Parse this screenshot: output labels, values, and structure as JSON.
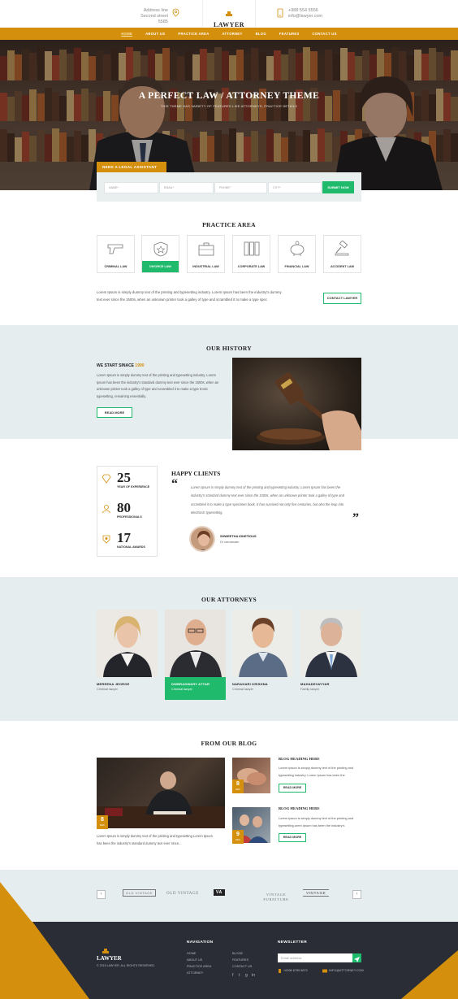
{
  "topbar": {
    "address_line1": "Address line",
    "address_line2": "Second street 5585",
    "phone": "+988 554 5556",
    "email": "info@lawyer.com",
    "brand": "LAWYER"
  },
  "nav": {
    "items": [
      "HOME",
      "ABOUT US",
      "PRACTICE AREA",
      "ATTORNEY",
      "BLOG",
      "FEATURES",
      "CONTACT US"
    ]
  },
  "hero": {
    "title": "A PERFECT LAW / ATTORNEY THEME",
    "subtitle": "THIS THEME HAS VARIETY OF FEATURES LIKE ATTORNEYS, PRACTICE DETAILS"
  },
  "assist_form": {
    "tab_label": "NEED A LEGAL ASSISTANT",
    "fields": [
      "NAME*",
      "EMAIL*",
      "PHONE*",
      "CITY*"
    ],
    "submit_label": "SUBMIT NOW"
  },
  "practice": {
    "title": "PRACTICE AREA",
    "items": [
      "CRIMINAL LAW",
      "DIVORCE LAW",
      "INDUSTRIAL LAW",
      "CORPORATE LAW",
      "FINANCIAL LAW",
      "ACCIDENT LAW"
    ],
    "text": "Lorem Ipsum is simply dummy text of the printing and typesetting industry. Lorem Ipsum has been the industry's dummy text ever since the 1500s, when an unknown printer took a galley of type and scrambled it to make a type spec",
    "contact_label": "CONTACT LAWYER"
  },
  "history": {
    "title": "OUR HISTORY",
    "heading": "WE START SINACE",
    "year": "1990",
    "text": "Lorem Ipsum is simply dummy text of the printing and typesetting industry. Lorem Ipsum has been the industry's standard dummy text ever since the 1500s, when an unknown printer took a galley of type and scrambled it to make a type tronic typesetting, remaining essentially.",
    "read_more": "READ MORE"
  },
  "stats": [
    {
      "number": "25",
      "label": "YEAR OF EXPERIENCE"
    },
    {
      "number": "80",
      "label": "PROFESSIONALS"
    },
    {
      "number": "17",
      "label": "NATIONAL AWARDS"
    }
  ],
  "clients": {
    "title": "HAPPY CLIENTS",
    "quote": "Lorem Ipsum is simply dummy text of the printing and typesetting industry. Lorem Ipsum has been the industry's standard dummy text ever since the 1500s, when an unknown printer took a galley of type and scrambled it to make a type specimen book. It has survived not only five centuries, but also the leap into electronic typesetting.",
    "author": "SHWEETHA IGNETIOUS",
    "author_role": "Dr vandanam"
  },
  "attorneys": {
    "title": "OUR ATTORNEYS",
    "items": [
      {
        "name": "MEREENA JEORGE",
        "role": "Criminal lawyer"
      },
      {
        "name": "DWBRADWARY ATTAR",
        "role": "Criminal lawyer"
      },
      {
        "name": "NARAHARI KRISHNA",
        "role": "Criminal lawyer"
      },
      {
        "name": "MAHADEVAYYAR",
        "role": "Family lawyer"
      }
    ]
  },
  "blog": {
    "title": "FROM OUR BLOG",
    "main": {
      "day": "8",
      "month": "DEC",
      "text": "Lorem Ipsum is simply dummy text of the printing and typesetting Lorem Ipsum has been the industry's standard dummy text ever since..."
    },
    "posts": [
      {
        "day": "8",
        "month": "DEC",
        "heading": "BLOG HEADING HERE",
        "text": "Lorem Ipsum is simply dummy text of the printing and typesetting industry. Lorem Ipsum has been the",
        "read_more": "READ MORE"
      },
      {
        "day": "9",
        "month": "DEC",
        "heading": "BLOG HEADING HERE",
        "text": "Lorem Ipsum is simply dummy text of the printing and typesetting.orem Ipsum has been the industry's",
        "read_more": "READ MORE"
      }
    ]
  },
  "partners": {
    "logos": [
      "OLD VINTAGE",
      "OLD VINTAGE",
      "VA",
      "VINTAGE FURNITURE",
      "VINTAGE"
    ],
    "prev": "‹",
    "next": "›"
  },
  "footer": {
    "brand": "LAWYER",
    "copyright": "© 2015 LAWYER. ALL RIGHTS RESERVED.",
    "nav_title": "NAVIGATION",
    "nav_col1": [
      "HOME",
      "ABOUT US",
      "PRACTICE AREA",
      "ATTORNEY"
    ],
    "nav_col2": [
      "BLOGE",
      "FEATURES",
      "CONTACT US"
    ],
    "newsletter_title": "NEWSLETTER",
    "newsletter_placeholder": "Email address",
    "phone": "+0098 8789 8873",
    "email": "INFO@ATTORNEY.COM"
  },
  "colors": {
    "accent": "#d4900d",
    "green": "#1fba6c",
    "footer_bg": "#2a2d36",
    "light_bg": "#e6edef"
  }
}
